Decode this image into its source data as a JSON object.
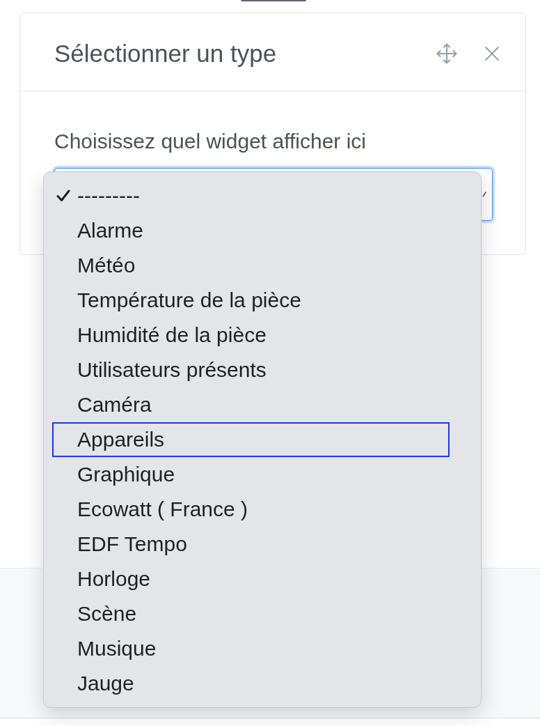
{
  "modal": {
    "title": "Sélectionner un type"
  },
  "field": {
    "label": "Choisissez quel widget afficher ici",
    "expanded": true,
    "options": [
      {
        "label": "---------",
        "selected": true,
        "focused": false
      },
      {
        "label": "Alarme",
        "selected": false,
        "focused": false
      },
      {
        "label": "Météo",
        "selected": false,
        "focused": false
      },
      {
        "label": "Température de la pièce",
        "selected": false,
        "focused": false
      },
      {
        "label": "Humidité de la pièce",
        "selected": false,
        "focused": false
      },
      {
        "label": "Utilisateurs présents",
        "selected": false,
        "focused": false
      },
      {
        "label": "Caméra",
        "selected": false,
        "focused": false
      },
      {
        "label": "Appareils",
        "selected": false,
        "focused": true
      },
      {
        "label": "Graphique",
        "selected": false,
        "focused": false
      },
      {
        "label": "Ecowatt ( France )",
        "selected": false,
        "focused": false
      },
      {
        "label": "EDF Tempo",
        "selected": false,
        "focused": false
      },
      {
        "label": "Horloge",
        "selected": false,
        "focused": false
      },
      {
        "label": "Scène",
        "selected": false,
        "focused": false
      },
      {
        "label": "Musique",
        "selected": false,
        "focused": false
      },
      {
        "label": "Jauge",
        "selected": false,
        "focused": false
      }
    ]
  }
}
